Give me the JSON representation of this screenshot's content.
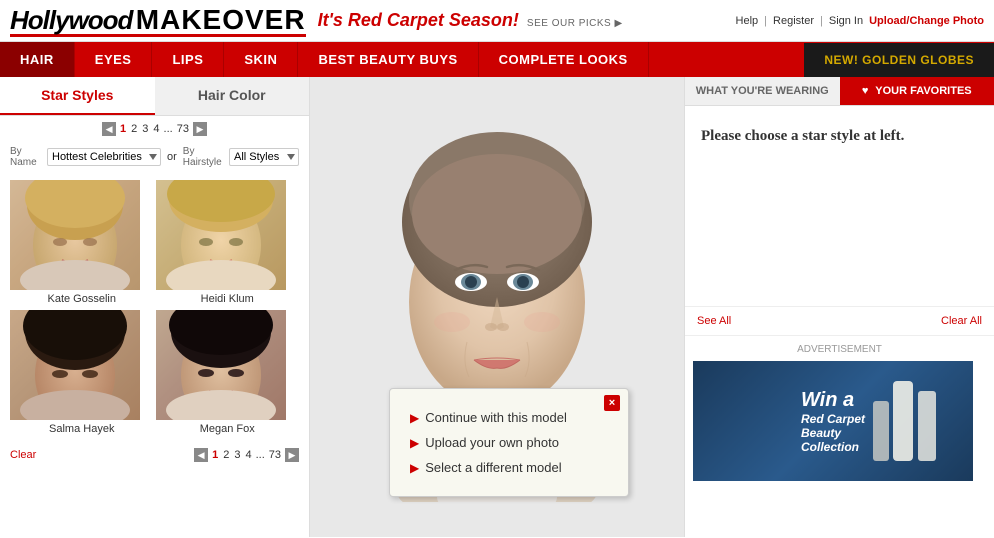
{
  "header": {
    "logo_italic": "Hollywood",
    "logo_bold": "MAKEOVER",
    "tagline": "It's Red Carpet Season!",
    "see_picks": "SEE OUR PICKS ▶",
    "links": {
      "help": "Help",
      "register": "Register",
      "sign_in": "Sign In",
      "upload": "Upload/Change Photo"
    }
  },
  "nav": {
    "items": [
      {
        "label": "HAIR",
        "active": true
      },
      {
        "label": "EYES",
        "active": false
      },
      {
        "label": "LIPS",
        "active": false
      },
      {
        "label": "SKIN",
        "active": false
      },
      {
        "label": "BEST BEAUTY BUYS",
        "active": false
      },
      {
        "label": "COMPLETE LOOKS",
        "active": false
      },
      {
        "label": "NEW! GOLDEN GLOBES",
        "active": false,
        "golden": true
      }
    ]
  },
  "left_panel": {
    "tabs": [
      {
        "label": "Star Styles",
        "active": true
      },
      {
        "label": "Hair Color",
        "active": false
      }
    ],
    "pagination": {
      "current": "1",
      "pages": [
        "1",
        "2",
        "3",
        "4",
        "...",
        "73"
      ],
      "prev_arrow": "◀",
      "next_arrow": "▶"
    },
    "filter": {
      "by_name_label": "By Name",
      "by_hairstyle_label": "By Hairstyle",
      "name_options": [
        "Hottest Celebrities"
      ],
      "style_options": [
        "All Styles"
      ],
      "or_text": "or"
    },
    "celebrities": [
      {
        "name": "Kate Gosselin",
        "color": "kate"
      },
      {
        "name": "Heidi Klum",
        "color": "heidi"
      },
      {
        "name": "Salma Hayek",
        "color": "salma"
      },
      {
        "name": "Megan Fox",
        "color": "megan"
      }
    ],
    "clear_label": "Clear"
  },
  "center_panel": {
    "popup": {
      "options": [
        "Continue with this model",
        "Upload your own photo",
        "Select a different model"
      ],
      "close_label": "×"
    }
  },
  "right_panel": {
    "tabs": [
      {
        "label": "WHAT YOU'RE WEARING",
        "active": true
      },
      {
        "label": "♥ YOUR FAVORITES",
        "active": false,
        "favorites": true
      }
    ],
    "message": "Please choose a star style at left.",
    "see_all": "See All",
    "clear_all": "Clear All",
    "ad": {
      "label": "ADVERTISEMENT",
      "text_win": "Win a",
      "text_sub": "Red Carpet\nBeauty\nCollection"
    }
  }
}
